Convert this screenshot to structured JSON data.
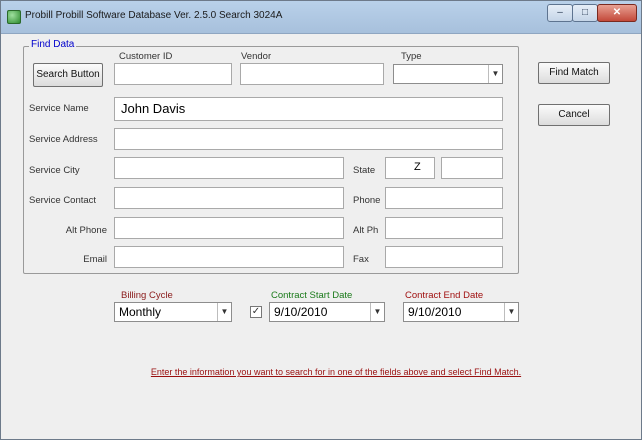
{
  "window": {
    "title": "Probill  Probill Software Database  Ver. 2.5.0  Search  3024A",
    "icon": "app-icon",
    "controls": {
      "minimize": "–",
      "maximize": "□",
      "close": "✕"
    }
  },
  "group": {
    "title": "Find Data"
  },
  "labels": {
    "customer_id": "Customer ID",
    "vendor": "Vendor",
    "type": "Type",
    "service_name": "Service Name",
    "service_address": "Service Address",
    "service_city": "Service City",
    "state": "State",
    "service_contact": "Service Contact",
    "phone": "Phone",
    "alt_phone": "Alt Phone",
    "alt_phone2": "Alt Ph",
    "email": "Email",
    "fax": "Fax"
  },
  "fields": {
    "customer_id": "",
    "vendor": "",
    "service_name": "John Davis",
    "service_address": "",
    "service_city": "",
    "state": "",
    "state_zip": "Z",
    "zip": "",
    "service_contact": "",
    "phone": "",
    "alt_phone": "",
    "alt_phone2": "",
    "email": "",
    "fax": ""
  },
  "buttons": {
    "search_button": "Search Button",
    "find_match": "Find Match",
    "cancel": "Cancel"
  },
  "billing": {
    "cycle_label": "Billing Cycle",
    "cycle_value": "Monthly",
    "start_label": "Contract Start Date",
    "start_value": "9/10/2010",
    "start_checked": true,
    "end_label": "Contract End Date",
    "end_value": "9/10/2010"
  },
  "hint": "Enter the information you want to search for in one of the fields above and select Find Match.",
  "colors": {
    "group_title": "#0000cc",
    "start_label": "#1a7a1a",
    "end_label": "#a01010",
    "hint": "#9a1010"
  }
}
